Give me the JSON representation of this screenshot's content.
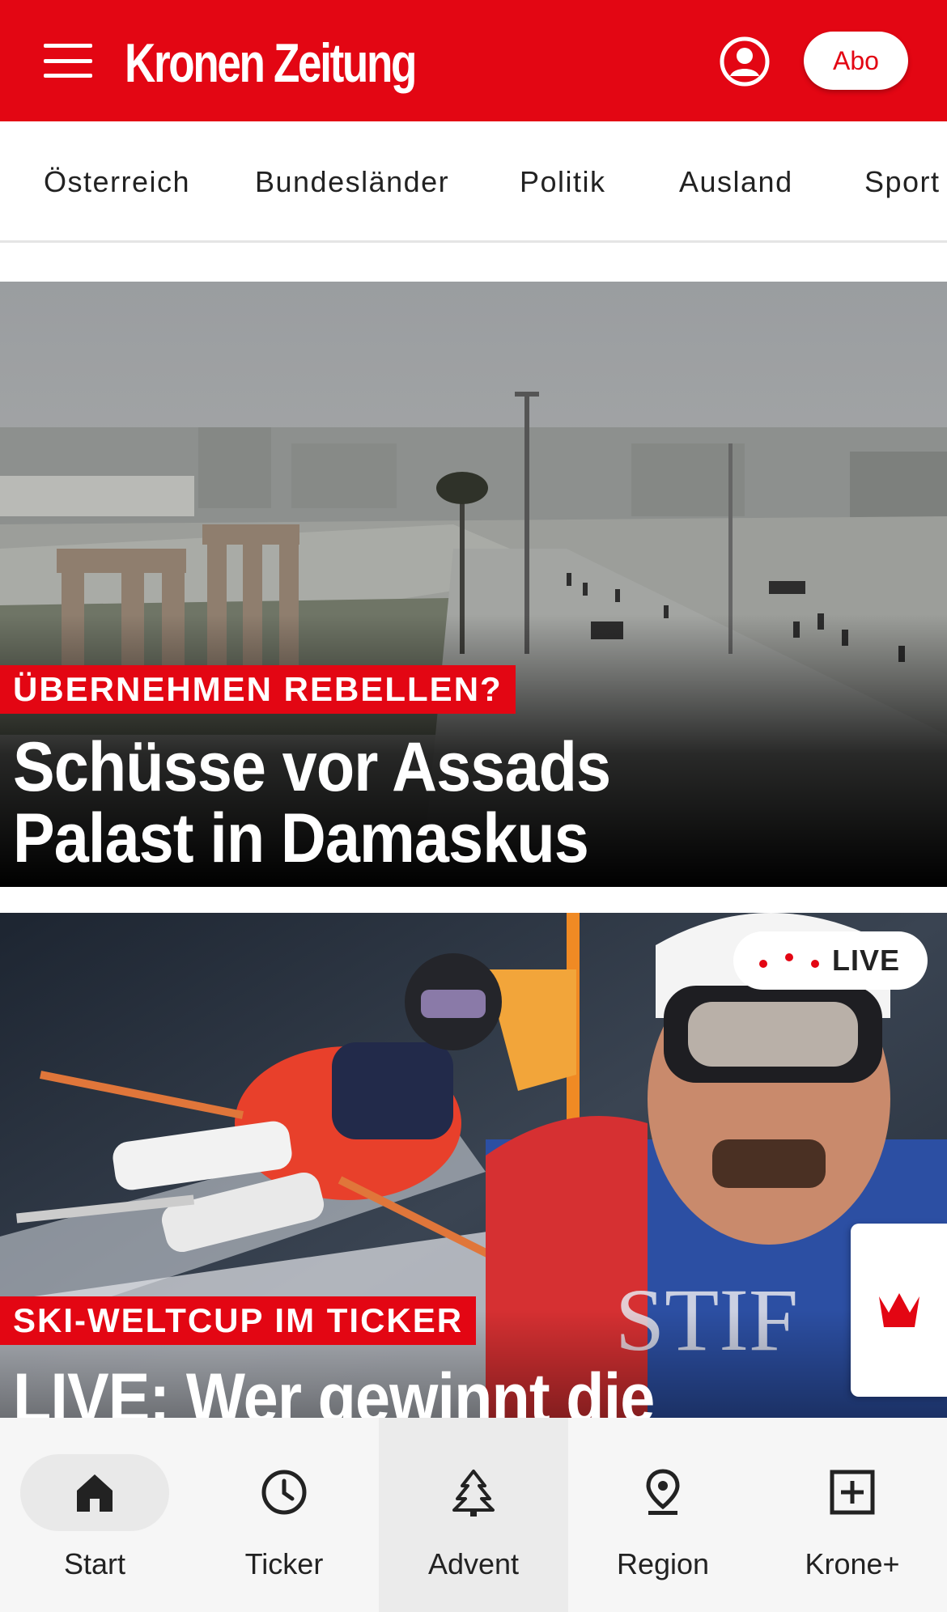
{
  "header": {
    "logo_text": "Kronen Zeitung",
    "abo_label": "Abo",
    "brand_color": "#e30613"
  },
  "categories": [
    "Österreich",
    "Bundesländer",
    "Politik",
    "Ausland",
    "Sport"
  ],
  "articles": [
    {
      "kicker": "ÜBERNEHMEN REBELLEN?",
      "headline_line1": "Schüsse vor Assads",
      "headline_line2": "Palast in Damaskus"
    },
    {
      "kicker": "SKI-WELTCUP IM TICKER",
      "headline_line1": "LIVE: Wer gewinnt die",
      "live_label": "LIVE"
    }
  ],
  "bottom_nav": [
    {
      "label": "Start",
      "icon": "home-icon",
      "selected": true
    },
    {
      "label": "Ticker",
      "icon": "clock-icon"
    },
    {
      "label": "Advent",
      "icon": "tree-icon"
    },
    {
      "label": "Region",
      "icon": "location-pin-icon"
    },
    {
      "label": "Krone+",
      "icon": "plus-box-icon"
    }
  ]
}
